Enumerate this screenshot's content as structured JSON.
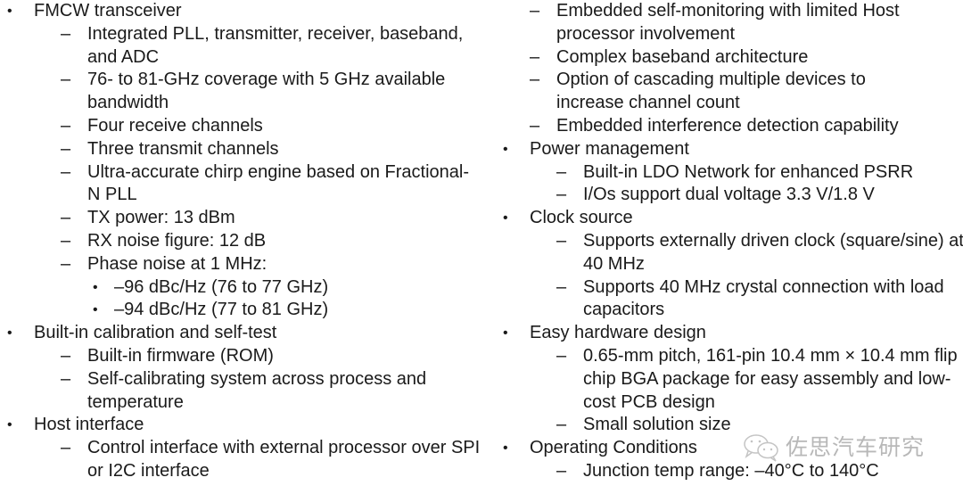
{
  "markers": {
    "bullet": "•",
    "dash": "–"
  },
  "left_column": {
    "fmcw": {
      "label": "FMCW transceiver",
      "items": [
        "Integrated PLL, transmitter, receiver, baseband, and ADC",
        "76- to 81-GHz coverage with 5 GHz available bandwidth",
        "Four receive channels",
        "Three transmit channels",
        "Ultra-accurate chirp engine based on Fractional-N PLL",
        "TX power: 13 dBm",
        "RX noise figure: 12 dB",
        "Phase noise at 1 MHz:"
      ],
      "phase_noise": [
        "–96 dBc/Hz (76 to 77 GHz)",
        "–94 dBc/Hz (77 to 81 GHz)"
      ]
    },
    "calibration": {
      "label": "Built-in calibration and self-test",
      "items": [
        "Built-in firmware (ROM)",
        "Self-calibrating system across process and temperature"
      ]
    },
    "host": {
      "label": "Host interface",
      "items": [
        "Control interface with external processor over SPI or I2C interface"
      ]
    }
  },
  "right_column": {
    "continued_items": [
      "Embedded self-monitoring with limited Host processor involvement",
      "Complex baseband architecture",
      "Option of cascading multiple devices to increase channel count",
      "Embedded interference detection capability"
    ],
    "power": {
      "label": "Power management",
      "items": [
        "Built-in LDO Network for enhanced PSRR",
        "I/Os support dual voltage 3.3 V/1.8 V"
      ]
    },
    "clock": {
      "label": "Clock source",
      "items": [
        "Supports externally driven clock (square/sine) at 40 MHz",
        "Supports 40 MHz crystal connection with load capacitors"
      ]
    },
    "hardware": {
      "label": "Easy hardware design",
      "items": [
        "0.65-mm pitch, 161-pin 10.4 mm × 10.4 mm flip chip BGA package for easy assembly and low-cost PCB design",
        "Small solution size"
      ]
    },
    "operating": {
      "label": "Operating Conditions",
      "items": [
        "Junction temp range: –40°C to 140°C"
      ]
    }
  },
  "watermark": {
    "icon": "wechat-icon",
    "text": "佐思汽车研究"
  }
}
